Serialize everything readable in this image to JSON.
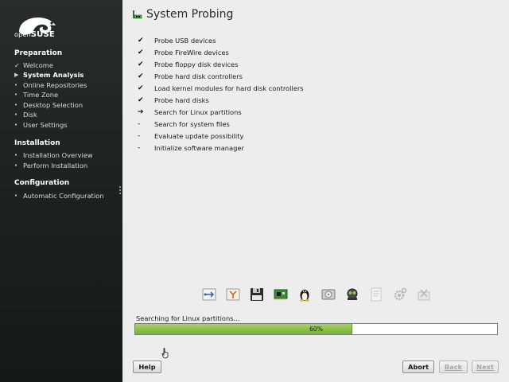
{
  "brand": {
    "logo_prefix": "open",
    "logo_suffix": "SUSE"
  },
  "sidebar": {
    "sections": [
      {
        "title": "Preparation",
        "steps": [
          {
            "label": "Welcome",
            "state": "done"
          },
          {
            "label": "System Analysis",
            "state": "active"
          },
          {
            "label": "Online Repositories",
            "state": "pending"
          },
          {
            "label": "Time Zone",
            "state": "pending"
          },
          {
            "label": "Desktop Selection",
            "state": "pending"
          },
          {
            "label": "Disk",
            "state": "pending"
          },
          {
            "label": "User Settings",
            "state": "pending"
          }
        ]
      },
      {
        "title": "Installation",
        "steps": [
          {
            "label": "Installation Overview",
            "state": "pending"
          },
          {
            "label": "Perform Installation",
            "state": "pending"
          }
        ]
      },
      {
        "title": "Configuration",
        "steps": [
          {
            "label": "Automatic Configuration",
            "state": "pending"
          }
        ]
      }
    ]
  },
  "main": {
    "title": "System Probing",
    "tasks": [
      {
        "label": "Probe USB devices",
        "status": "done",
        "mark": "✔"
      },
      {
        "label": "Probe FireWire devices",
        "status": "done",
        "mark": "✔"
      },
      {
        "label": "Probe floppy disk devices",
        "status": "done",
        "mark": "✔"
      },
      {
        "label": "Probe hard disk controllers",
        "status": "done",
        "mark": "✔"
      },
      {
        "label": "Load kernel modules for hard disk controllers",
        "status": "done",
        "mark": "✔"
      },
      {
        "label": "Probe hard disks",
        "status": "done",
        "mark": "✔"
      },
      {
        "label": "Search for Linux partitions",
        "status": "current",
        "mark": "➔"
      },
      {
        "label": "Search for system files",
        "status": "pending",
        "mark": "-"
      },
      {
        "label": "Evaluate update possibility",
        "status": "pending",
        "mark": "-"
      },
      {
        "label": "Initialize software manager",
        "status": "pending",
        "mark": "-"
      }
    ],
    "stage_icons": [
      {
        "name": "usb-icon",
        "active": true
      },
      {
        "name": "firewire-icon",
        "active": true
      },
      {
        "name": "floppy-icon",
        "active": true
      },
      {
        "name": "controller-card-icon",
        "active": true
      },
      {
        "name": "tux-penguin-icon",
        "active": true
      },
      {
        "name": "hard-disk-icon",
        "active": true
      },
      {
        "name": "partition-search-icon",
        "active": true
      },
      {
        "name": "system-files-icon",
        "active": false
      },
      {
        "name": "update-gears-icon",
        "active": false
      },
      {
        "name": "software-manager-icon",
        "active": false
      }
    ],
    "progress": {
      "label": "Searching for Linux partitions...",
      "value": 60,
      "text": "60%"
    }
  },
  "buttons": {
    "help": "Help",
    "abort": "Abort",
    "back": "Back",
    "next": "Next"
  },
  "colors": {
    "sidebar_bg": "#1d1f1f",
    "progress_fill": "#8bc04a",
    "window_bg": "#ededed"
  }
}
